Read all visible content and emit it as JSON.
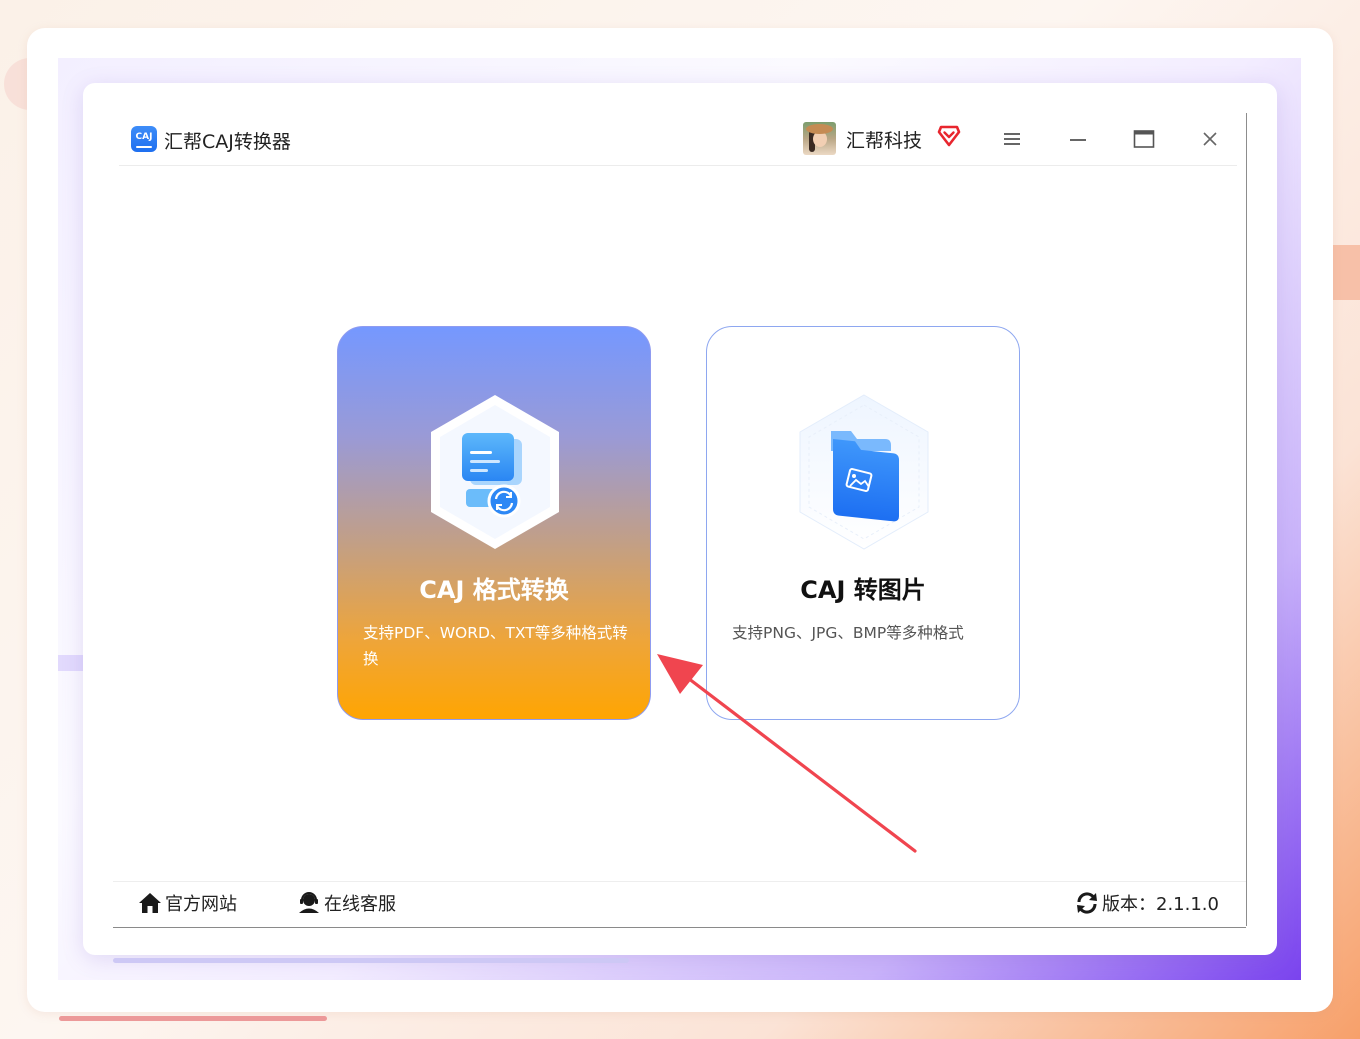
{
  "app": {
    "icon_text": "CAJ",
    "title": "汇帮CAJ转换器"
  },
  "user": {
    "name": "汇帮科技"
  },
  "window_controls": {
    "menu": "menu-icon",
    "minimize": "minimize-icon",
    "maximize": "maximize-icon",
    "close": "close-icon"
  },
  "cards": [
    {
      "title": "CAJ 格式转换",
      "description": "支持PDF、WORD、TXT等多种格式转换",
      "icon": "document-convert-icon",
      "state": "selected"
    },
    {
      "title": "CAJ 转图片",
      "description": "支持PNG、JPG、BMP等多种格式",
      "icon": "image-folder-icon",
      "state": "normal"
    }
  ],
  "footer": {
    "website": "官方网站",
    "service": "在线客服",
    "version": "版本：2.1.1.0"
  },
  "colors": {
    "accent_blue": "#2f7cf6",
    "card_gradient_top": "#7598ff",
    "card_gradient_bottom": "#ffa502",
    "annotation_arrow": "#f0454f"
  }
}
